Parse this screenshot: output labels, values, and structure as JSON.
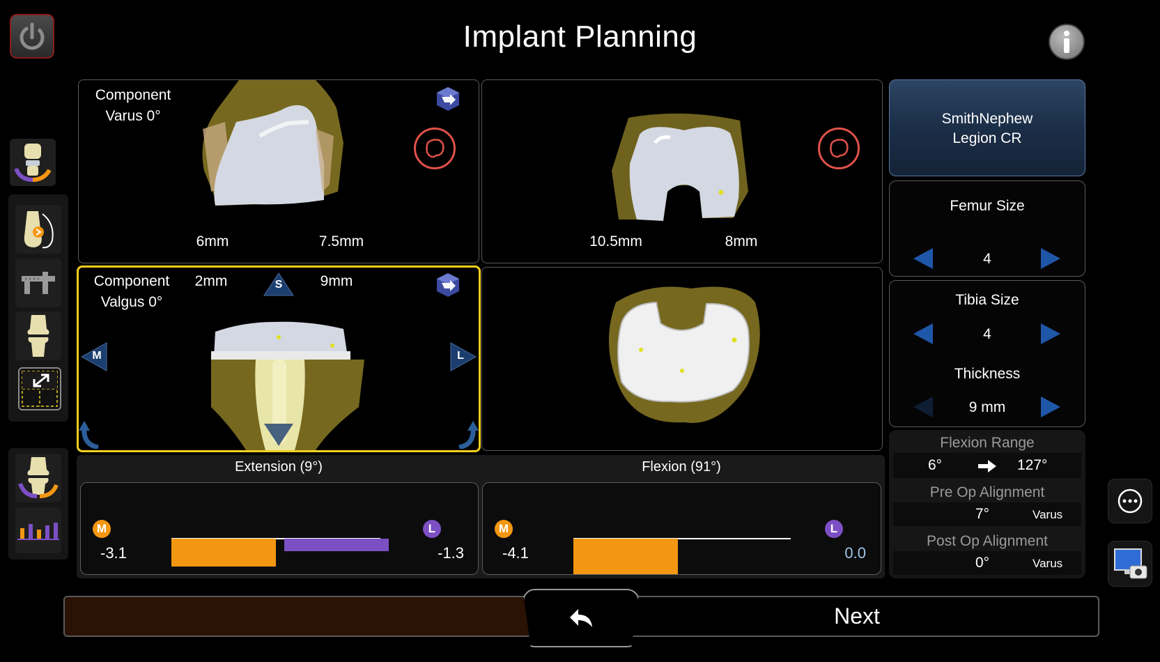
{
  "header": {
    "title": "Implant Planning"
  },
  "panels": {
    "top_left": {
      "label_line1": "Component",
      "label_line2": "Varus 0°",
      "left_measure": "6mm",
      "right_measure": "7.5mm"
    },
    "top_right": {
      "left_measure": "10.5mm",
      "right_measure": "8mm"
    },
    "bottom_left": {
      "label_line1": "Component",
      "label_line2": "Valgus 0°",
      "left_measure": "2mm",
      "right_measure": "9mm",
      "s_marker": "S",
      "m_marker": "M",
      "l_marker": "L"
    }
  },
  "gaps": {
    "extension": {
      "title": "Extension (9°)",
      "m_badge": "M",
      "l_badge": "L",
      "m_value": "-3.1",
      "l_value": "-1.3",
      "m_bar_fraction": 0.6,
      "l_bar_fraction": 0.6
    },
    "flexion": {
      "title": "Flexion (91°)",
      "m_badge": "M",
      "l_badge": "L",
      "m_value": "-4.1",
      "l_value": "0.0",
      "m_bar_fraction": 0.48,
      "l_bar_fraction": 0
    }
  },
  "right_panel": {
    "implant": {
      "line1": "SmithNephew",
      "line2": "Legion CR"
    },
    "femur": {
      "title": "Femur Size",
      "value": "4"
    },
    "tibia": {
      "title": "Tibia Size",
      "value": "4"
    },
    "thickness": {
      "title": "Thickness",
      "value": "9 mm"
    },
    "flexion_range": {
      "title": "Flexion Range",
      "from": "6°",
      "to": "127°"
    },
    "pre_op": {
      "title": "Pre Op Alignment",
      "value": "7°",
      "type": "Varus"
    },
    "post_op": {
      "title": "Post Op Alignment",
      "value": "0°",
      "type": "Varus"
    }
  },
  "footer": {
    "next_label": "Next",
    "progress_fraction": 0.47
  },
  "colors": {
    "accent_yellow": "#f1cf1e",
    "medial_orange": "#f39712",
    "lateral_purple": "#7c4fc4",
    "arrow_blue": "#1f57a8",
    "rotate_red": "#e0524a"
  }
}
